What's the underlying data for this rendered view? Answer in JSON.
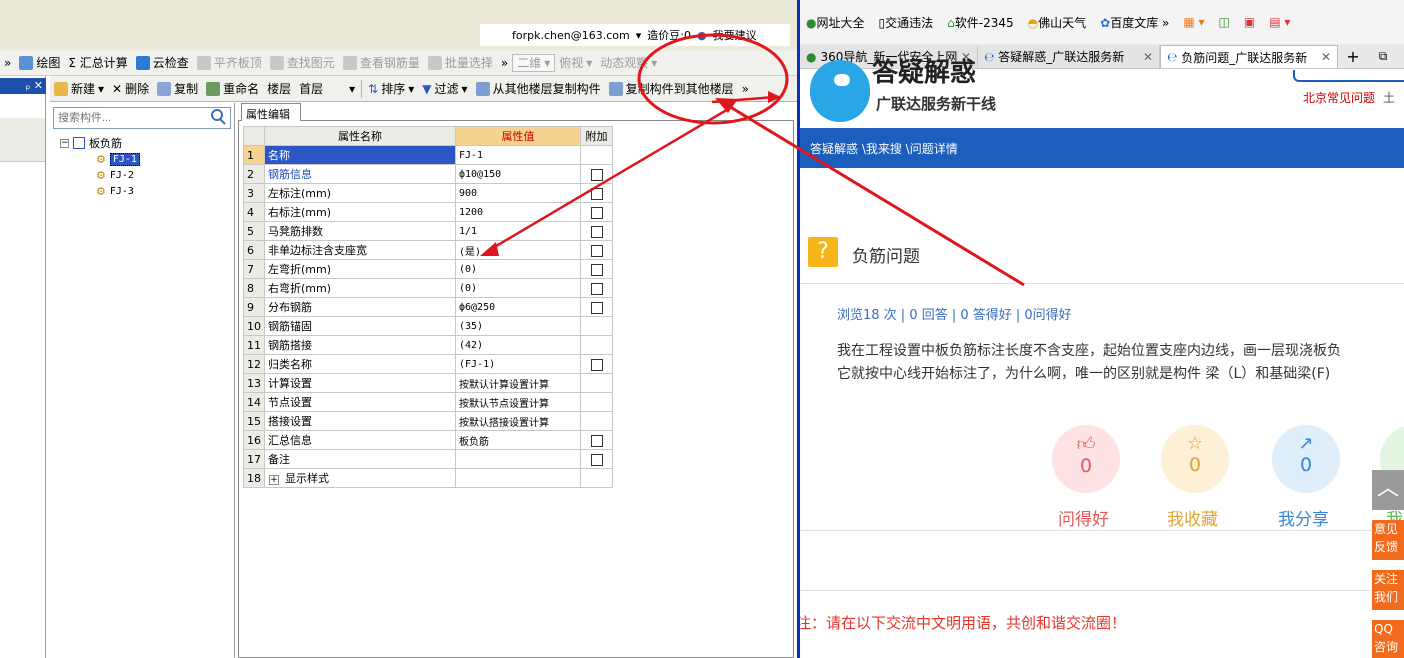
{
  "left_app": {
    "account": {
      "email": "forpk.chen@163.com",
      "coins": "造价豆:0",
      "suggest": "我要建议"
    },
    "toolbar1": [
      {
        "label": "绘图",
        "icon": "draw-icon"
      },
      {
        "label": "Σ 汇总计算",
        "icon": "sum-icon"
      },
      {
        "label": "云检查",
        "icon": "cloud-check-icon"
      },
      {
        "label": "平齐板顶",
        "icon": "align-top-icon",
        "disabled": true
      },
      {
        "label": "查找图元",
        "icon": "find-icon",
        "disabled": true
      },
      {
        "label": "查看钢筋量",
        "icon": "view-rebar-icon",
        "disabled": true
      },
      {
        "label": "批量选择",
        "icon": "batch-select-icon",
        "disabled": true
      },
      {
        "label": "二维",
        "icon": "2d-icon",
        "disabled": true
      },
      {
        "label": "俯视",
        "icon": "top-view-icon",
        "disabled": true
      },
      {
        "label": "动态观察",
        "icon": "orbit-icon",
        "disabled": true
      }
    ],
    "toolbar2": {
      "new": "新建",
      "delete": "删除",
      "copy": "复制",
      "rename": "重命名",
      "floor_label": "楼层",
      "floor_value": "首层",
      "sort": "排序",
      "filter": "过滤",
      "copy_from": "从其他楼层复制构件",
      "copy_to": "复制构件到其他楼层"
    },
    "search": {
      "placeholder": "搜索构件..."
    },
    "tree": {
      "root": "板负筋",
      "children": [
        "FJ-1",
        "FJ-2",
        "FJ-3"
      ],
      "selected": "FJ-1"
    },
    "panel_tab": "属性编辑",
    "table": {
      "headers": {
        "name": "属性名称",
        "value": "属性值",
        "extra": "附加"
      },
      "rows": [
        {
          "n": "1",
          "name": "名称",
          "value": "FJ-1",
          "cb": false
        },
        {
          "n": "2",
          "name": "钢筋信息",
          "value": "ф10@150",
          "cb": true
        },
        {
          "n": "3",
          "name": "左标注(mm)",
          "value": "900",
          "cb": true
        },
        {
          "n": "4",
          "name": "右标注(mm)",
          "value": "1200",
          "cb": true
        },
        {
          "n": "5",
          "name": "马凳筋排数",
          "value": "1/1",
          "cb": true
        },
        {
          "n": "6",
          "name": "非单边标注含支座宽",
          "value": "(是)",
          "cb": true
        },
        {
          "n": "7",
          "name": "左弯折(mm)",
          "value": "(0)",
          "cb": true
        },
        {
          "n": "8",
          "name": "右弯折(mm)",
          "value": "(0)",
          "cb": true
        },
        {
          "n": "9",
          "name": "分布钢筋",
          "value": "ф6@250",
          "cb": true
        },
        {
          "n": "10",
          "name": "钢筋锚固",
          "value": "(35)",
          "cb": false
        },
        {
          "n": "11",
          "name": "钢筋搭接",
          "value": "(42)",
          "cb": false
        },
        {
          "n": "12",
          "name": "归类名称",
          "value": "(FJ-1)",
          "cb": true
        },
        {
          "n": "13",
          "name": "计算设置",
          "value": "按默认计算设置计算",
          "cb": false
        },
        {
          "n": "14",
          "name": "节点设置",
          "value": "按默认节点设置计算",
          "cb": false
        },
        {
          "n": "15",
          "name": "搭接设置",
          "value": "按默认搭接设置计算",
          "cb": false
        },
        {
          "n": "16",
          "name": "汇总信息",
          "value": "板负筋",
          "cb": true
        },
        {
          "n": "17",
          "name": "备注",
          "value": "",
          "cb": true
        },
        {
          "n": "18",
          "name": "显示样式",
          "value": "",
          "cb": false
        }
      ]
    }
  },
  "browser": {
    "favorites": [
      "网址大全",
      "交通违法",
      "软件-2345",
      "佛山天气",
      "百度文库"
    ],
    "tabs": [
      {
        "title": "360导航_新一代安全上网",
        "active": false
      },
      {
        "title": "答疑解惑_广联达服务新",
        "active": false
      },
      {
        "title": "负筋问题_广联达服务新",
        "active": true
      }
    ],
    "site": {
      "logo_title": "答疑解惑",
      "logo_sub": "广联达服务新干线",
      "top_link": "北京常见问题",
      "top_link2": "土",
      "breadcrumb": "答疑解惑 \\我来搜 \\问题详情",
      "question_title": "负筋问题",
      "stats": "浏览18 次 | 0 回答 | 0 答得好 | 0问得好",
      "body_line1": "我在工程设置中板负筋标注长度不含支座，起始位置支座内边线，画一层现浇板负",
      "body_line2": "它就按中心线开始标注了，为什么啊，唯一的区别就是构件 梁（L）和基础梁(F)",
      "actions": [
        {
          "label": "问得好",
          "count": "0",
          "color": "#e35a5a",
          "bg": "#fde3e3"
        },
        {
          "label": "我收藏",
          "count": "0",
          "color": "#e0a534",
          "bg": "#fdf0d6"
        },
        {
          "label": "我分享",
          "count": "0",
          "color": "#3a86d6",
          "bg": "#dfeefb"
        },
        {
          "label": "我",
          "count": "",
          "color": "#5cb85c",
          "bg": "#e2f4e2"
        }
      ],
      "notice": "注：请在以下交流中文明用语，共创和谐交流圈！",
      "side_buttons": [
        "意见反馈",
        "关注我们",
        "QQ咨询"
      ]
    }
  }
}
